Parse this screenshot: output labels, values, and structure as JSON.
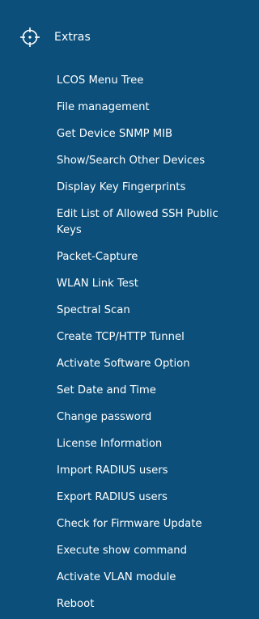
{
  "section": {
    "title": "Extras",
    "icon": "crosshair-circle-icon"
  },
  "menu": {
    "items": [
      {
        "label": "LCOS Menu Tree"
      },
      {
        "label": "File management"
      },
      {
        "label": "Get Device SNMP MIB"
      },
      {
        "label": "Show/Search Other Devices"
      },
      {
        "label": "Display Key Fingerprints"
      },
      {
        "label": "Edit List of Allowed SSH Public Keys"
      },
      {
        "label": "Packet-Capture"
      },
      {
        "label": "WLAN Link Test"
      },
      {
        "label": "Spectral Scan"
      },
      {
        "label": "Create TCP/HTTP Tunnel"
      },
      {
        "label": "Activate Software Option"
      },
      {
        "label": "Set Date and Time"
      },
      {
        "label": "Change password"
      },
      {
        "label": "License Information"
      },
      {
        "label": "Import RADIUS users"
      },
      {
        "label": "Export RADIUS users"
      },
      {
        "label": "Check for Firmware Update"
      },
      {
        "label": "Execute show command"
      },
      {
        "label": "Activate VLAN module"
      },
      {
        "label": "Reboot"
      }
    ]
  },
  "colors": {
    "background": "#0b4f7a",
    "text": "#ffffff"
  }
}
